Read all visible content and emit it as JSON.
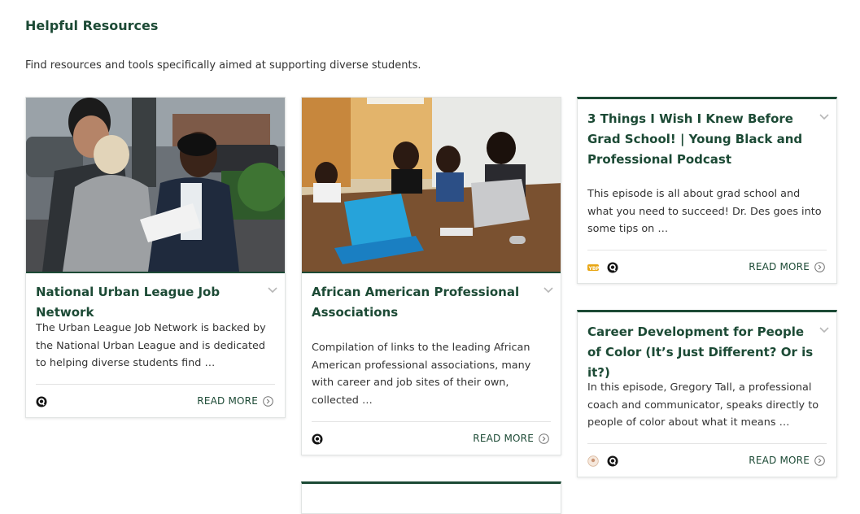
{
  "section": {
    "title": "Helpful Resources",
    "intro": "Find resources and tools specifically aimed at supporting diverse students."
  },
  "cards": [
    {
      "title": "National Urban League Job Network",
      "description": "The Urban League Job Network is backed by the National Urban League and is dedicated to helping diverse students find …",
      "read_more": "READ MORE",
      "icons": [
        "quora-q-icon"
      ]
    },
    {
      "title": "African American Professional Associations",
      "description": "Compilation of links to the leading African American professional associations, many with career and job sites of their own, collected …",
      "read_more": "READ MORE",
      "icons": [
        "quora-q-icon"
      ]
    },
    {
      "title": "3 Things I Wish I Knew Before Grad School! | Young Black and Professional Podcast",
      "description": "This episode is all about grad school and what you need to succeed! Dr. Des goes into some tips on …",
      "read_more": "READ MORE",
      "icons": [
        "podcast-logo-icon",
        "quora-q-icon"
      ]
    },
    {
      "title": "Career Development for People of Color (It’s Just Different? Or is it?)",
      "description": "In this episode, Gregory Tall, a professional coach and communicator, speaks directly to people of color about what it means …",
      "read_more": "READ MORE",
      "icons": [
        "podcast-avatar-icon",
        "quora-q-icon"
      ]
    }
  ],
  "colors": {
    "accent": "#1c4a35",
    "text": "#333333",
    "border": "#e1e4e3"
  }
}
